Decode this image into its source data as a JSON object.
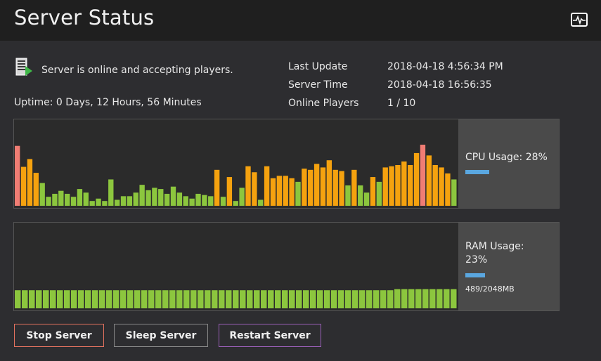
{
  "header": {
    "title": "Server Status",
    "monitor_icon": "activity-monitor-icon"
  },
  "status": {
    "icon": "server-online-icon",
    "message": "Server is online and accepting players.",
    "uptime": "Uptime: 0 Days, 12 Hours, 56 Minutes"
  },
  "info": {
    "rows": [
      {
        "label": "Last Update",
        "value": "2018-04-18 4:56:34 PM"
      },
      {
        "label": "Server Time",
        "value": "2018-04-18 16:56:35"
      },
      {
        "label": "Online Players",
        "value": "1 / 10"
      }
    ]
  },
  "colors": {
    "low": "#8cc63e",
    "mid": "#f5a20f",
    "high": "#f07d74",
    "meter": "#5aa7e0",
    "stop_border": "#e3725f",
    "restart_border": "#9a5fb8"
  },
  "cpu": {
    "label": "CPU Usage: 28%",
    "usage_percent": 28
  },
  "ram": {
    "label_line1": "RAM Usage:",
    "label_line2": "23%",
    "usage_percent": 23,
    "detail": "489/2048MB"
  },
  "chart_data": [
    {
      "type": "bar",
      "title": "",
      "ylim": [
        0,
        100
      ],
      "values": [
        100,
        65,
        78,
        55,
        38,
        15,
        20,
        25,
        20,
        15,
        28,
        22,
        8,
        12,
        8,
        44,
        10,
        16,
        16,
        22,
        35,
        26,
        30,
        28,
        20,
        32,
        22,
        16,
        12,
        20,
        18,
        16,
        60,
        15,
        48,
        8,
        30,
        66,
        56,
        10,
        66,
        46,
        50,
        50,
        46,
        40,
        62,
        60,
        70,
        64,
        76,
        60,
        58,
        34,
        60,
        34,
        22,
        48,
        40,
        64,
        66,
        68,
        74,
        68,
        88,
        102,
        84,
        68,
        64,
        54,
        44
      ],
      "thresholds": {
        "mid": 45,
        "high": 90
      }
    },
    {
      "type": "bar",
      "title": "",
      "ylim": [
        0,
        100
      ],
      "values": [
        23,
        23,
        23,
        23,
        23,
        23,
        23,
        23,
        23,
        23,
        23,
        23,
        23,
        23,
        23,
        23,
        23,
        23,
        23,
        23,
        23,
        23,
        23,
        23,
        23,
        23,
        23,
        23,
        23,
        23,
        23,
        23,
        23,
        23,
        23,
        23,
        23,
        23,
        23,
        23,
        23,
        23,
        23,
        23,
        23,
        23,
        23,
        23,
        23,
        23,
        23,
        23,
        23,
        23,
        23,
        23,
        23,
        23,
        23,
        23,
        23,
        23,
        23
      ]
    }
  ],
  "buttons": {
    "stop": "Stop Server",
    "sleep": "Sleep Server",
    "restart": "Restart Server"
  }
}
